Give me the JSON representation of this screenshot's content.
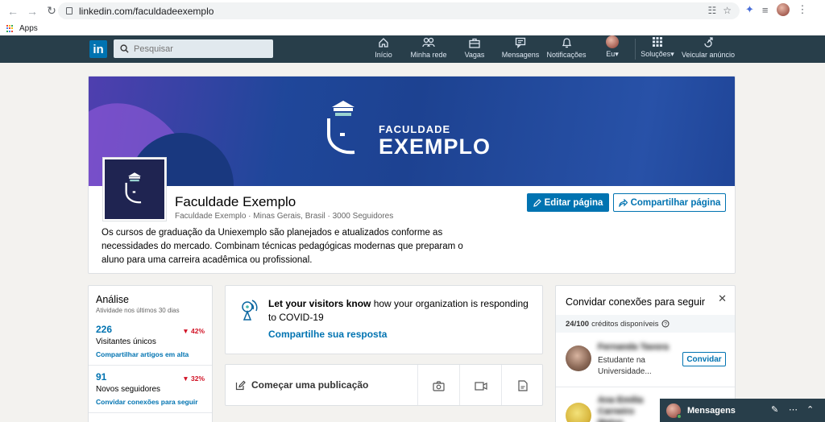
{
  "browser": {
    "url": "linkedin.com/faculdadeexemplo",
    "bookmarks_apps": "Apps"
  },
  "nav": {
    "logo": "in",
    "search_placeholder": "Pesquisar",
    "items": [
      {
        "label": "Início",
        "icon": "home-icon"
      },
      {
        "label": "Minha rede",
        "icon": "network-icon"
      },
      {
        "label": "Vagas",
        "icon": "briefcase-icon"
      },
      {
        "label": "Mensagens",
        "icon": "messages-icon"
      },
      {
        "label": "Notificações",
        "icon": "bell-icon"
      },
      {
        "label": "Eu",
        "icon": "avatar"
      },
      {
        "label": "Soluções",
        "icon": "grid-icon"
      },
      {
        "label": "Veicular anúncio",
        "icon": "megaphone-icon"
      }
    ]
  },
  "banner": {
    "title_small": "FACULDADE",
    "title_large": "EXEMPLO"
  },
  "profile": {
    "name": "Faculdade Exemplo",
    "subtitle": "Faculdade Exemplo · Minas Gerais, Brasil · 3000 Seguidores",
    "description": "Os cursos de graduação da Uniexemplo são planejados e atualizados conforme as necessidades do mercado. Combinam técnicas pedagógicas modernas que preparam o aluno para uma carreira acadêmica ou profissional.",
    "edit_button": "Editar página",
    "share_button": "Compartilhar página"
  },
  "analytics": {
    "title": "Análise",
    "subtitle": "Atividade nos últimos 30 dias",
    "stats": [
      {
        "value": "226",
        "change": "42%",
        "label": "Visitantes únicos",
        "link": "Compartilhar artigos em alta"
      },
      {
        "value": "91",
        "change": "32%",
        "label": "Novos seguidores",
        "link": "Convidar conexões para seguir"
      }
    ]
  },
  "covid": {
    "bold": "Let your visitors know",
    "text": " how your organization is responding to COVID-19",
    "link": "Compartilhe sua resposta"
  },
  "post": {
    "start_label": "Começar uma publicação"
  },
  "invite": {
    "title": "Convidar conexões para seguir",
    "credits_count": "24/100",
    "credits_text": "créditos disponíveis",
    "people": [
      {
        "name": "Fernanda Tavora",
        "desc": "Estudante na Universidade...",
        "button": "Convidar"
      },
      {
        "name": "Ana Emilia Carneiro Matos",
        "desc": ""
      }
    ]
  },
  "messaging": {
    "label": "Mensagens"
  },
  "colors": {
    "accent": "#0073b1",
    "nav_bg": "#283e4a",
    "negative": "#d11124"
  }
}
